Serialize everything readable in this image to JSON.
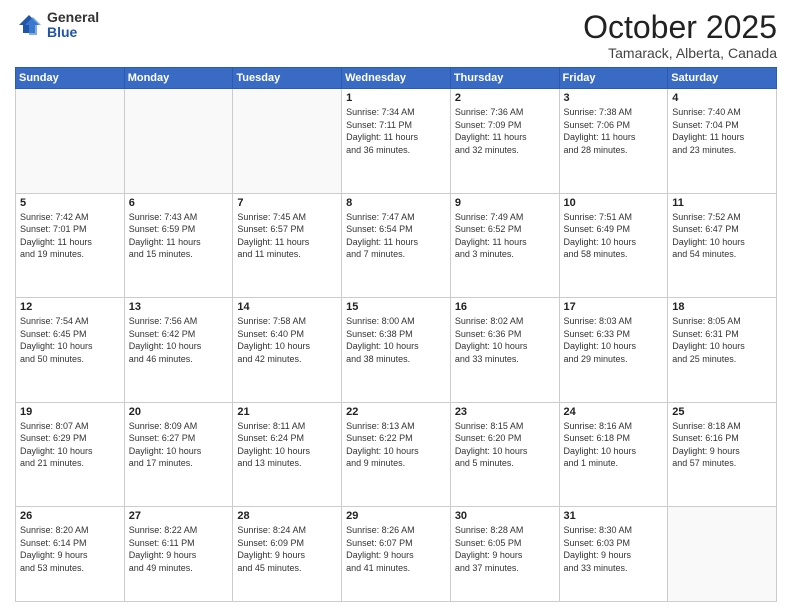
{
  "logo": {
    "general": "General",
    "blue": "Blue"
  },
  "title": "October 2025",
  "subtitle": "Tamarack, Alberta, Canada",
  "days_of_week": [
    "Sunday",
    "Monday",
    "Tuesday",
    "Wednesday",
    "Thursday",
    "Friday",
    "Saturday"
  ],
  "weeks": [
    [
      {
        "day": "",
        "info": ""
      },
      {
        "day": "",
        "info": ""
      },
      {
        "day": "",
        "info": ""
      },
      {
        "day": "1",
        "info": "Sunrise: 7:34 AM\nSunset: 7:11 PM\nDaylight: 11 hours\nand 36 minutes."
      },
      {
        "day": "2",
        "info": "Sunrise: 7:36 AM\nSunset: 7:09 PM\nDaylight: 11 hours\nand 32 minutes."
      },
      {
        "day": "3",
        "info": "Sunrise: 7:38 AM\nSunset: 7:06 PM\nDaylight: 11 hours\nand 28 minutes."
      },
      {
        "day": "4",
        "info": "Sunrise: 7:40 AM\nSunset: 7:04 PM\nDaylight: 11 hours\nand 23 minutes."
      }
    ],
    [
      {
        "day": "5",
        "info": "Sunrise: 7:42 AM\nSunset: 7:01 PM\nDaylight: 11 hours\nand 19 minutes."
      },
      {
        "day": "6",
        "info": "Sunrise: 7:43 AM\nSunset: 6:59 PM\nDaylight: 11 hours\nand 15 minutes."
      },
      {
        "day": "7",
        "info": "Sunrise: 7:45 AM\nSunset: 6:57 PM\nDaylight: 11 hours\nand 11 minutes."
      },
      {
        "day": "8",
        "info": "Sunrise: 7:47 AM\nSunset: 6:54 PM\nDaylight: 11 hours\nand 7 minutes."
      },
      {
        "day": "9",
        "info": "Sunrise: 7:49 AM\nSunset: 6:52 PM\nDaylight: 11 hours\nand 3 minutes."
      },
      {
        "day": "10",
        "info": "Sunrise: 7:51 AM\nSunset: 6:49 PM\nDaylight: 10 hours\nand 58 minutes."
      },
      {
        "day": "11",
        "info": "Sunrise: 7:52 AM\nSunset: 6:47 PM\nDaylight: 10 hours\nand 54 minutes."
      }
    ],
    [
      {
        "day": "12",
        "info": "Sunrise: 7:54 AM\nSunset: 6:45 PM\nDaylight: 10 hours\nand 50 minutes."
      },
      {
        "day": "13",
        "info": "Sunrise: 7:56 AM\nSunset: 6:42 PM\nDaylight: 10 hours\nand 46 minutes."
      },
      {
        "day": "14",
        "info": "Sunrise: 7:58 AM\nSunset: 6:40 PM\nDaylight: 10 hours\nand 42 minutes."
      },
      {
        "day": "15",
        "info": "Sunrise: 8:00 AM\nSunset: 6:38 PM\nDaylight: 10 hours\nand 38 minutes."
      },
      {
        "day": "16",
        "info": "Sunrise: 8:02 AM\nSunset: 6:36 PM\nDaylight: 10 hours\nand 33 minutes."
      },
      {
        "day": "17",
        "info": "Sunrise: 8:03 AM\nSunset: 6:33 PM\nDaylight: 10 hours\nand 29 minutes."
      },
      {
        "day": "18",
        "info": "Sunrise: 8:05 AM\nSunset: 6:31 PM\nDaylight: 10 hours\nand 25 minutes."
      }
    ],
    [
      {
        "day": "19",
        "info": "Sunrise: 8:07 AM\nSunset: 6:29 PM\nDaylight: 10 hours\nand 21 minutes."
      },
      {
        "day": "20",
        "info": "Sunrise: 8:09 AM\nSunset: 6:27 PM\nDaylight: 10 hours\nand 17 minutes."
      },
      {
        "day": "21",
        "info": "Sunrise: 8:11 AM\nSunset: 6:24 PM\nDaylight: 10 hours\nand 13 minutes."
      },
      {
        "day": "22",
        "info": "Sunrise: 8:13 AM\nSunset: 6:22 PM\nDaylight: 10 hours\nand 9 minutes."
      },
      {
        "day": "23",
        "info": "Sunrise: 8:15 AM\nSunset: 6:20 PM\nDaylight: 10 hours\nand 5 minutes."
      },
      {
        "day": "24",
        "info": "Sunrise: 8:16 AM\nSunset: 6:18 PM\nDaylight: 10 hours\nand 1 minute."
      },
      {
        "day": "25",
        "info": "Sunrise: 8:18 AM\nSunset: 6:16 PM\nDaylight: 9 hours\nand 57 minutes."
      }
    ],
    [
      {
        "day": "26",
        "info": "Sunrise: 8:20 AM\nSunset: 6:14 PM\nDaylight: 9 hours\nand 53 minutes."
      },
      {
        "day": "27",
        "info": "Sunrise: 8:22 AM\nSunset: 6:11 PM\nDaylight: 9 hours\nand 49 minutes."
      },
      {
        "day": "28",
        "info": "Sunrise: 8:24 AM\nSunset: 6:09 PM\nDaylight: 9 hours\nand 45 minutes."
      },
      {
        "day": "29",
        "info": "Sunrise: 8:26 AM\nSunset: 6:07 PM\nDaylight: 9 hours\nand 41 minutes."
      },
      {
        "day": "30",
        "info": "Sunrise: 8:28 AM\nSunset: 6:05 PM\nDaylight: 9 hours\nand 37 minutes."
      },
      {
        "day": "31",
        "info": "Sunrise: 8:30 AM\nSunset: 6:03 PM\nDaylight: 9 hours\nand 33 minutes."
      },
      {
        "day": "",
        "info": ""
      }
    ]
  ]
}
